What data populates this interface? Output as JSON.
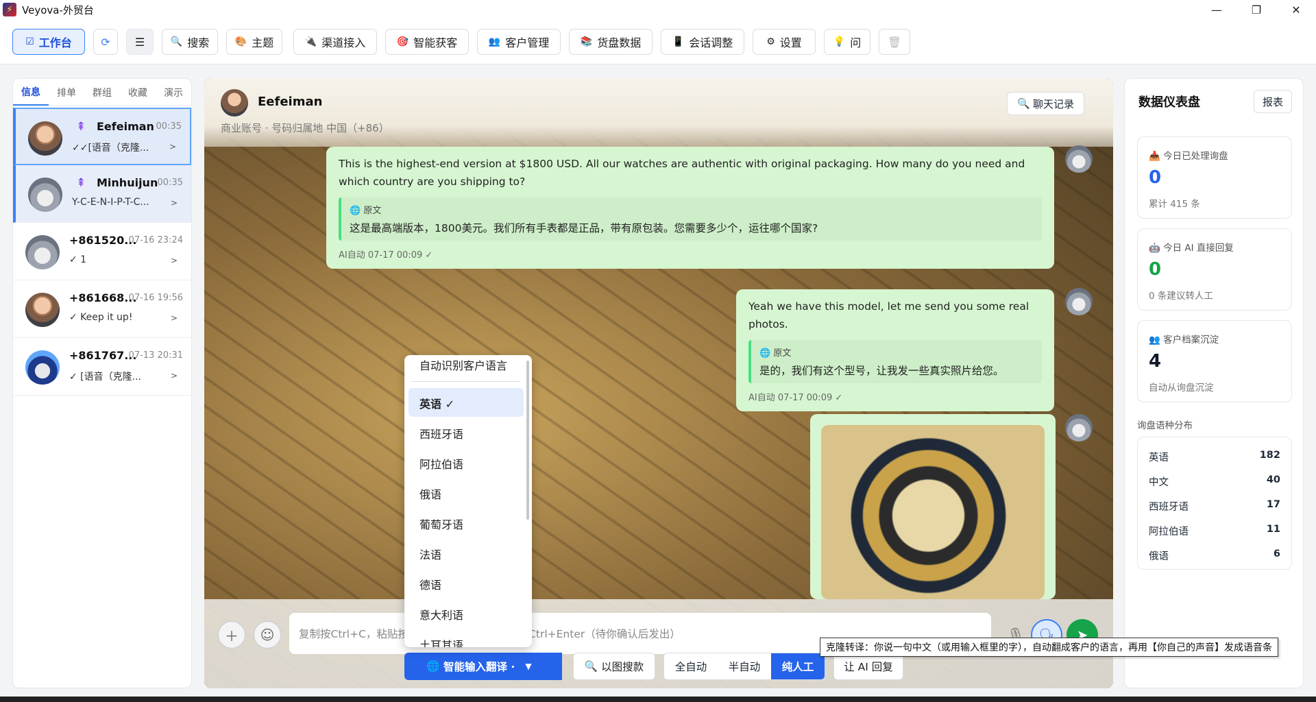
{
  "window": {
    "title": "Veyova-外贸台",
    "controls": {
      "minimize": "—",
      "maximize": "❐",
      "close": "✕"
    }
  },
  "toolbar": {
    "workbench": "工作台",
    "search": "搜索",
    "theme": "主题",
    "channel": "渠道接入",
    "leads": "智能获客",
    "customers": "客户管理",
    "inventory": "货盘数据",
    "session": "会话调整",
    "settings": "设置",
    "ask": "问"
  },
  "left": {
    "tabs": [
      "信息",
      "排单",
      "群组",
      "收藏",
      "演示"
    ],
    "contacts": [
      {
        "name": "Eefeiman",
        "time": "00:35",
        "msg": "✓✓[语音（克隆..."
      },
      {
        "name": "Minhuijun",
        "time": "00:35",
        "msg": "Y-C-E-N-I-P-T-C..."
      },
      {
        "name": "+861520...",
        "time": "07-16 23:24",
        "msg": "✓ 1"
      },
      {
        "name": "+861668...",
        "time": "07-16 19:56",
        "msg": "✓ Keep it up!"
      },
      {
        "name": "+861767...",
        "time": "07-13 20:31",
        "msg": "✓ [语音（克隆..."
      }
    ],
    "arrow": ">"
  },
  "chat": {
    "name": "Eefeiman",
    "sub": "商业账号 · 号码归属地 中国（+86）",
    "history_btn": "聊天记录",
    "messages": [
      {
        "text": "This is the highest-end version at $1800 USD. All our watches are authentic with original packaging. How many do you need and which country are you shipping to?",
        "quote_label": "原文",
        "quote": "这是最高端版本，1800美元。我们所有手表都是正品，带有原包装。您需要多少个，运往哪个国家?",
        "meta": "AI自动   07-17 00:09   ✓"
      },
      {
        "text": "Yeah we have this model, let me send you some real photos.",
        "quote_label": "原文",
        "quote": "是的，我们有这个型号，让我发一些真实照片给您。",
        "meta": "AI自动   07-17 00:09   ✓"
      }
    ],
    "input_placeholder": "复制按Ctrl+C，粘贴按Ctrl+V，发送当前信息按Ctrl+Enter（待你确认后发出）",
    "translate_btn": "智能输入翻译 · 英语",
    "image_search": "以图搜款",
    "modes": [
      "全自动",
      "半自动",
      "纯人工"
    ],
    "ai_reply": "让 AI 回复"
  },
  "dropdown": {
    "auto": "自动识别客户语言",
    "items": [
      "英语 ✓",
      "西班牙语",
      "阿拉伯语",
      "俄语",
      "葡萄牙语",
      "法语",
      "德语",
      "意大利语",
      "土耳其语"
    ]
  },
  "dashboard": {
    "title": "数据仪表盘",
    "report_btn": "报表",
    "stats": [
      {
        "label": "今日已处理询盘",
        "value": "0",
        "sub": "累计 415 条",
        "color": "#2563eb"
      },
      {
        "label": "今日 AI 直接回复",
        "value": "0",
        "sub": "0 条建议转人工",
        "color": "#16a34a"
      },
      {
        "label": "客户档案沉淀",
        "value": "4",
        "sub": "自动从询盘沉淀",
        "color": "#111827"
      }
    ],
    "dist_title": "询盘语种分布",
    "dist": [
      {
        "lang": "英语",
        "count": "182"
      },
      {
        "lang": "中文",
        "count": "40"
      },
      {
        "lang": "西班牙语",
        "count": "17"
      },
      {
        "lang": "阿拉伯语",
        "count": "11"
      },
      {
        "lang": "俄语",
        "count": "6"
      }
    ]
  },
  "tooltip": "克隆转译：你说一句中文（或用输入框里的字），自动翻成客户的语言，再用【你自己的声音】发成语音条"
}
